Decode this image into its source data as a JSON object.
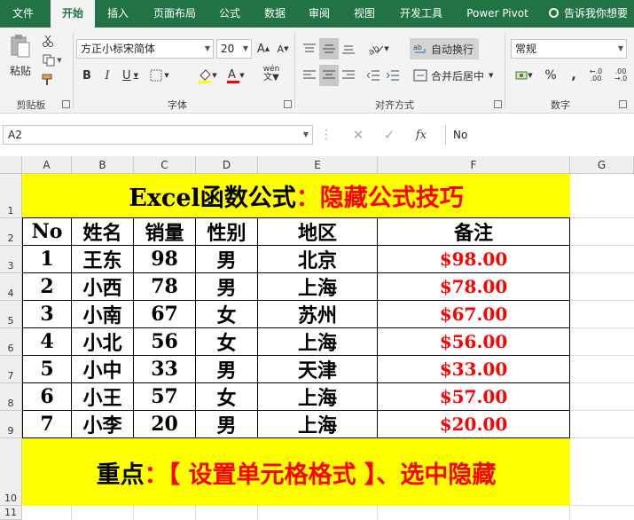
{
  "tabs": [
    {
      "label": "文件",
      "active": false
    },
    {
      "label": "开始",
      "active": true
    },
    {
      "label": "插入",
      "active": false
    },
    {
      "label": "页面布局",
      "active": false
    },
    {
      "label": "公式",
      "active": false
    },
    {
      "label": "数据",
      "active": false
    },
    {
      "label": "审阅",
      "active": false
    },
    {
      "label": "视图",
      "active": false
    },
    {
      "label": "开发工具",
      "active": false
    },
    {
      "label": "Power Pivot",
      "active": false
    }
  ],
  "tell_me": "告诉我你想要",
  "ribbon": {
    "clipboard": {
      "paste_label": "粘贴",
      "group_label": "剪贴板"
    },
    "font": {
      "font_name": "方正小标宋简体",
      "font_size": "20",
      "group_label": "字体",
      "phonetic": "wén"
    },
    "alignment": {
      "wrap_text": "自动换行",
      "merge_center": "合并后居中",
      "group_label": "对齐方式"
    },
    "number": {
      "format": "常规",
      "group_label": "数字"
    }
  },
  "formula_bar": {
    "name_box": "A2",
    "formula": "No",
    "fx": "fx"
  },
  "columns": [
    "A",
    "B",
    "C",
    "D",
    "E",
    "F",
    "G"
  ],
  "rows": [
    "1",
    "2",
    "3",
    "4",
    "5",
    "6",
    "7",
    "8",
    "9",
    "10",
    "11"
  ],
  "sheet": {
    "title_black": "Excel函数公式",
    "title_red": "：隐藏公式技巧",
    "headers": [
      "No",
      "姓名",
      "销量",
      "性别",
      "地区",
      "备注"
    ],
    "data": [
      [
        "1",
        "王东",
        "98",
        "男",
        "北京",
        "$98.00"
      ],
      [
        "2",
        "小西",
        "78",
        "男",
        "上海",
        "$78.00"
      ],
      [
        "3",
        "小南",
        "67",
        "女",
        "苏州",
        "$67.00"
      ],
      [
        "4",
        "小北",
        "56",
        "女",
        "上海",
        "$56.00"
      ],
      [
        "5",
        "小中",
        "33",
        "男",
        "天津",
        "$33.00"
      ],
      [
        "6",
        "小王",
        "57",
        "女",
        "上海",
        "$57.00"
      ],
      [
        "7",
        "小李",
        "20",
        "男",
        "上海",
        "$20.00"
      ]
    ],
    "footer_black": "重点",
    "footer_red": "：【 设置单元格格式 】、选中隐藏"
  },
  "colors": {
    "accent": "#217346",
    "highlight": "#ffff00",
    "red_text": "#ff0000"
  }
}
